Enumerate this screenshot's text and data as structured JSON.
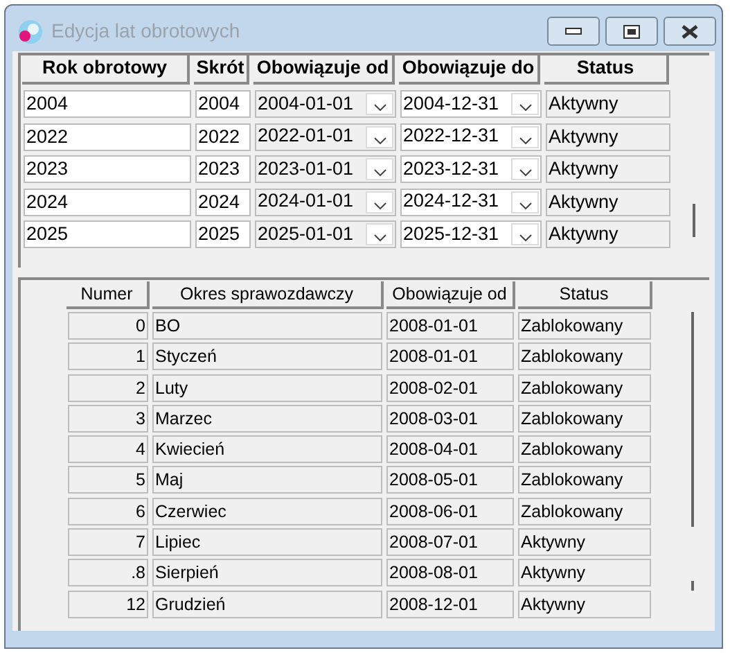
{
  "window": {
    "title": "Edycja lat obrotowych"
  },
  "years_table": {
    "columns": [
      "Rok obrotowy",
      "Skrót",
      "Obowiązuje od",
      "Obowiązuje do",
      "Status"
    ],
    "rows": [
      {
        "year": "2004",
        "short": "2004",
        "from": "2004-01-01",
        "to": "2004-12-31",
        "status": "Aktywny"
      },
      {
        "year": "2022",
        "short": "2022",
        "from": "2022-01-01",
        "to": "2022-12-31",
        "status": "Aktywny"
      },
      {
        "year": "2023",
        "short": "2023",
        "from": "2023-01-01",
        "to": "2023-12-31",
        "status": "Aktywny"
      },
      {
        "year": "2024",
        "short": "2024",
        "from": "2024-01-01",
        "to": "2024-12-31",
        "status": "Aktywny"
      },
      {
        "year": "2025",
        "short": "2025",
        "from": "2025-01-01",
        "to": "2025-12-31",
        "status": "Aktywny"
      }
    ]
  },
  "periods_table": {
    "columns": [
      "Numer",
      "Okres sprawozdawczy",
      "Obowiązuje od",
      "Status"
    ],
    "rows": [
      {
        "number": "0",
        "name": "BO",
        "from": "2008-01-01",
        "status": "Zablokowany"
      },
      {
        "number": "1",
        "name": "Styczeń",
        "from": "2008-01-01",
        "status": "Zablokowany"
      },
      {
        "number": "2",
        "name": "Luty",
        "from": "2008-02-01",
        "status": "Zablokowany"
      },
      {
        "number": "3",
        "name": "Marzec",
        "from": "2008-03-01",
        "status": "Zablokowany"
      },
      {
        "number": "4",
        "name": "Kwiecień",
        "from": "2008-04-01",
        "status": "Zablokowany"
      },
      {
        "number": "5",
        "name": "Maj",
        "from": "2008-05-01",
        "status": "Zablokowany"
      },
      {
        "number": "6",
        "name": "Czerwiec",
        "from": "2008-06-01",
        "status": "Zablokowany"
      },
      {
        "number": "7",
        "name": "Lipiec",
        "from": "2008-07-01",
        "status": "Aktywny"
      },
      {
        "number": ".8",
        "name": "Sierpień",
        "from": "2008-08-01",
        "status": "Aktywny"
      },
      {
        "number": "12",
        "name": "Grudzień",
        "from": "2008-12-01",
        "status": "Aktywny"
      }
    ]
  }
}
